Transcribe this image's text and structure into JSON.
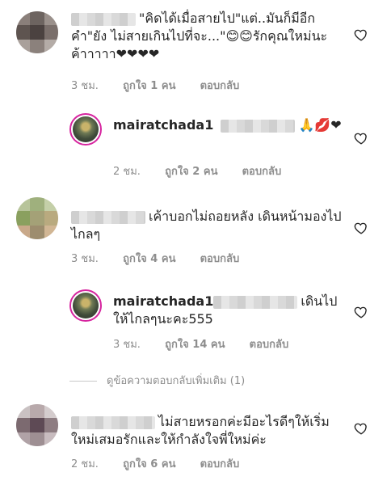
{
  "comments": [
    {
      "text": "\"คิดได้เมื่อสายไป\"แต่..มันก็มีอีกคำ\"ยัง ไม่สายเกินไปที่จะ...\"😊😊รักคุณใหม่นะค้าาาาา❤❤❤❤",
      "time": "3 ชม.",
      "likes": "ถูกใจ 1 คน",
      "reply": "ตอบกลับ"
    },
    {
      "username": "mairatchada1",
      "text": "🙏💋❤",
      "time": "2 ชม.",
      "likes": "ถูกใจ 2 คน",
      "reply": "ตอบกลับ"
    },
    {
      "text": "เค้าบอกไม่ถอยหลัง เดินหน้ามองไปไกลๆ",
      "time": "3 ชม.",
      "likes": "ถูกใจ 4 คน",
      "reply": "ตอบกลับ"
    },
    {
      "username": "mairatchada1",
      "text": "เดินไปให้ไกลๆนะคะ555",
      "time": "3 ชม.",
      "likes": "ถูกใจ 14 คน",
      "reply": "ตอบกลับ"
    },
    {
      "text": "ไม่สายหรอกค่ะมีอะไรดีๆให้เริ่มใหม่เสมอรักและให้กำลังใจพี่ใหม่ค่ะ",
      "time": "2 ชม.",
      "likes": "ถูกใจ 6 คน",
      "reply": "ตอบกลับ"
    }
  ],
  "view_more_replies": "ดูข้อความตอบกลับเพิ่มเติม (1)",
  "icons": {
    "like": "heart-outline-icon"
  },
  "colors": {
    "text": "#262626",
    "meta": "#8e8e8e",
    "story_ring": "#d6249f"
  }
}
